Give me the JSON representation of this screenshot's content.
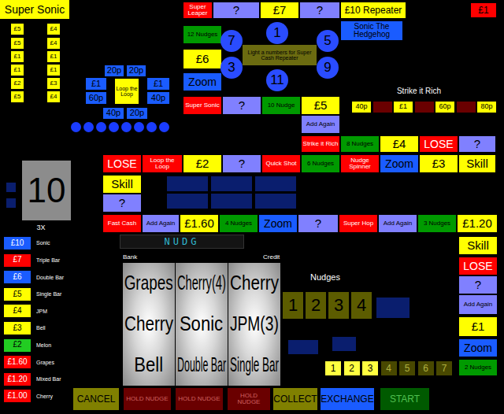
{
  "title": "Super Sonic",
  "prize_ladder": {
    "left": [
      "£5",
      "£5",
      "£1",
      "£1",
      "£2",
      "£5"
    ],
    "right": [
      "£4",
      "£4",
      "£1",
      "£1",
      "£3",
      "£4"
    ]
  },
  "loop_the_loop": {
    "label": "Loop the Loop",
    "values": [
      "20p",
      "20p",
      "£1",
      "£1",
      "60p",
      "40p",
      "40p",
      "20p"
    ]
  },
  "corner_prize": "£1",
  "board": [
    {
      "text": "Super Leaper",
      "kind": "feature"
    },
    {
      "text": "?",
      "kind": "mystery"
    },
    {
      "text": "£7",
      "kind": "cash"
    },
    {
      "text": "?",
      "kind": "mystery"
    },
    {
      "text": "£10 Repeater",
      "kind": "cash"
    },
    {
      "text": "Sonic The Hedgehog",
      "kind": "special"
    },
    {
      "text": "12 Nudges",
      "kind": "nudge"
    },
    {
      "text": "£6",
      "kind": "cash"
    },
    {
      "text": "Zoom",
      "kind": "zoom"
    },
    {
      "text": "Super Sonic",
      "kind": "feature"
    },
    {
      "text": "?",
      "kind": "mystery"
    },
    {
      "text": "10 Nudge",
      "kind": "nudge"
    },
    {
      "text": "£5",
      "kind": "cash"
    },
    {
      "text": "Add Again",
      "kind": "mystery"
    },
    {
      "text": "Strike it Rich",
      "kind": "feature"
    },
    {
      "text": "8 Nudges",
      "kind": "nudge"
    },
    {
      "text": "£4",
      "kind": "cash"
    },
    {
      "text": "LOSE",
      "kind": "lose"
    },
    {
      "text": "?",
      "kind": "mystery"
    },
    {
      "text": "LOSE",
      "kind": "lose"
    },
    {
      "text": "Loop the Loop",
      "kind": "feature"
    },
    {
      "text": "£2",
      "kind": "cash"
    },
    {
      "text": "?",
      "kind": "mystery"
    },
    {
      "text": "Quick Shot",
      "kind": "feature"
    },
    {
      "text": "6 Nudges",
      "kind": "nudge"
    },
    {
      "text": "Nudge Spinner",
      "kind": "feature"
    },
    {
      "text": "Zoom",
      "kind": "zoom"
    },
    {
      "text": "£3",
      "kind": "cash"
    },
    {
      "text": "Skill",
      "kind": "skill"
    },
    {
      "text": "Skill",
      "kind": "skill"
    },
    {
      "text": "?",
      "kind": "mystery"
    },
    {
      "text": "Fast Cash",
      "kind": "feature"
    },
    {
      "text": "Add Again",
      "kind": "mystery"
    },
    {
      "text": "£1.60",
      "kind": "cash"
    },
    {
      "text": "4 Nudges",
      "kind": "nudge"
    },
    {
      "text": "Zoom",
      "kind": "zoom"
    },
    {
      "text": "?",
      "kind": "mystery"
    },
    {
      "text": "Super Hop",
      "kind": "feature"
    },
    {
      "text": "Add Again",
      "kind": "mystery"
    },
    {
      "text": "3 Nudges",
      "kind": "nudge"
    },
    {
      "text": "£1.20",
      "kind": "cash"
    },
    {
      "text": "Skill",
      "kind": "skill"
    },
    {
      "text": "LOSE",
      "kind": "lose"
    },
    {
      "text": "?",
      "kind": "mystery"
    },
    {
      "text": "Add Again",
      "kind": "mystery"
    },
    {
      "text": "£1",
      "kind": "cash"
    },
    {
      "text": "Zoom",
      "kind": "zoom"
    },
    {
      "text": "2 Nudges",
      "kind": "nudge"
    }
  ],
  "number_lamps": {
    "numbers": [
      "7",
      "1",
      "5",
      "3",
      "9",
      "11"
    ],
    "caption": "Light a numbers for Super Cash Repeater"
  },
  "strike_it_rich": {
    "title": "Strike it Rich",
    "steps": [
      {
        "text": "40p",
        "lit": true
      },
      {
        "text": "",
        "lit": false
      },
      {
        "text": "£1",
        "lit": true
      },
      {
        "text": "",
        "lit": false
      },
      {
        "text": "60p",
        "lit": true
      },
      {
        "text": "",
        "lit": false
      },
      {
        "text": "80p",
        "lit": true
      }
    ]
  },
  "multiplier": {
    "value": "10",
    "label": "3X"
  },
  "paytable": [
    {
      "amount": "£10",
      "symbol": "Sonic",
      "color": "#1a5cff"
    },
    {
      "amount": "£7",
      "symbol": "Triple Bar",
      "color": "#ff0000"
    },
    {
      "amount": "£6",
      "symbol": "Double Bar",
      "color": "#1a5cff"
    },
    {
      "amount": "£5",
      "symbol": "Single Bar",
      "color": "#ffff00"
    },
    {
      "amount": "£4",
      "symbol": "JPM",
      "color": "#ffff00"
    },
    {
      "amount": "£3",
      "symbol": "Bell",
      "color": "#ffff00"
    },
    {
      "amount": "£2",
      "symbol": "Melon",
      "color": "#22cc22"
    },
    {
      "amount": "£1.60",
      "symbol": "Grapes",
      "color": "#ff0000"
    },
    {
      "amount": "£1.20",
      "symbol": "Mixed Bar",
      "color": "#ff0000"
    },
    {
      "amount": "£1.00",
      "symbol": "Cherry",
      "color": "#ff0000"
    }
  ],
  "display": {
    "text": "NUDG"
  },
  "bank_label": "Bank",
  "credit_label": "Credit",
  "reels": [
    [
      "Grapes",
      "Cherry",
      "Bell"
    ],
    [
      "Cherry(4)",
      "Sonic",
      "Double Bar"
    ],
    [
      "Cherry",
      "JPM(3)",
      "Single Bar"
    ]
  ],
  "nudges": {
    "label": "Nudges",
    "digits": [
      "1",
      "2",
      "3",
      "4"
    ]
  },
  "number_row": [
    {
      "text": "1",
      "lit": true
    },
    {
      "text": "2",
      "lit": true
    },
    {
      "text": "3",
      "lit": true
    },
    {
      "text": "4",
      "lit": false
    },
    {
      "text": "5",
      "lit": false
    },
    {
      "text": "6",
      "lit": false
    },
    {
      "text": "7",
      "lit": false
    }
  ],
  "buttons": [
    {
      "label": "CANCEL",
      "color": "#808000",
      "lit": true
    },
    {
      "label": "HOLD NUDGE",
      "color": "#6a0000",
      "lit": false
    },
    {
      "label": "HOLD NUDGE",
      "color": "#6a0000",
      "lit": false
    },
    {
      "label": "HOLD NUDGE",
      "color": "#6a0000",
      "lit": false
    },
    {
      "label": "COLLECT",
      "color": "#808000",
      "lit": true
    },
    {
      "label": "EXCHANGE",
      "color": "#1a5cff",
      "lit": true
    },
    {
      "label": "START",
      "color": "#005a00",
      "lit": false
    }
  ]
}
